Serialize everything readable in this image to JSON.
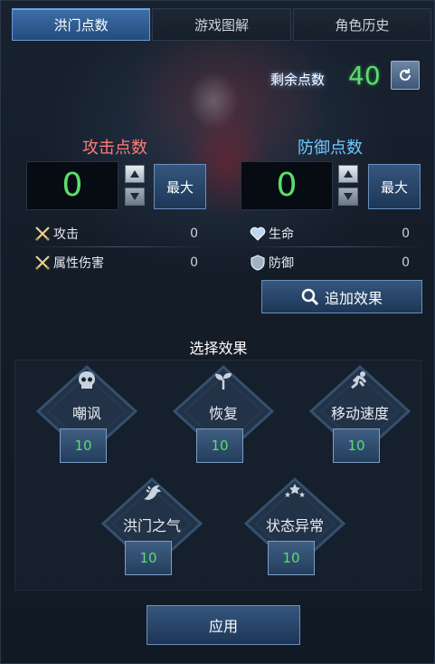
{
  "tabs": [
    {
      "label": "洪门点数",
      "active": true
    },
    {
      "label": "游戏图解",
      "active": false
    },
    {
      "label": "角色历史",
      "active": false
    }
  ],
  "remaining": {
    "label": "剩余点数",
    "value": "40"
  },
  "attack": {
    "title": "攻击点数",
    "value": "0",
    "max_label": "最大",
    "stats": [
      {
        "icon": "crossed-swords-icon",
        "label": "攻击",
        "value": "0"
      },
      {
        "icon": "crossed-swords-icon",
        "label": "属性伤害",
        "value": "0"
      }
    ]
  },
  "defense": {
    "title": "防御点数",
    "value": "0",
    "max_label": "最大",
    "stats": [
      {
        "icon": "heart-icon",
        "label": "生命",
        "value": "0"
      },
      {
        "icon": "shield-icon",
        "label": "防御",
        "value": "0"
      }
    ]
  },
  "add_effect_label": "追加效果",
  "choose_effect_title": "选择效果",
  "effects": [
    {
      "icon": "skull-icon",
      "label": "嘲讽",
      "value": "10"
    },
    {
      "icon": "sprout-icon",
      "label": "恢复",
      "value": "10"
    },
    {
      "icon": "running-icon",
      "label": "移动速度",
      "value": "10"
    },
    {
      "icon": "dragon-icon",
      "label": "洪门之气",
      "value": "10"
    },
    {
      "icon": "stars-icon",
      "label": "状态异常",
      "value": "10"
    }
  ],
  "apply_label": "应用",
  "colors": {
    "accent_green": "#58e06a",
    "attack_red": "#ff7b7b",
    "defense_blue": "#6fc8ff"
  }
}
